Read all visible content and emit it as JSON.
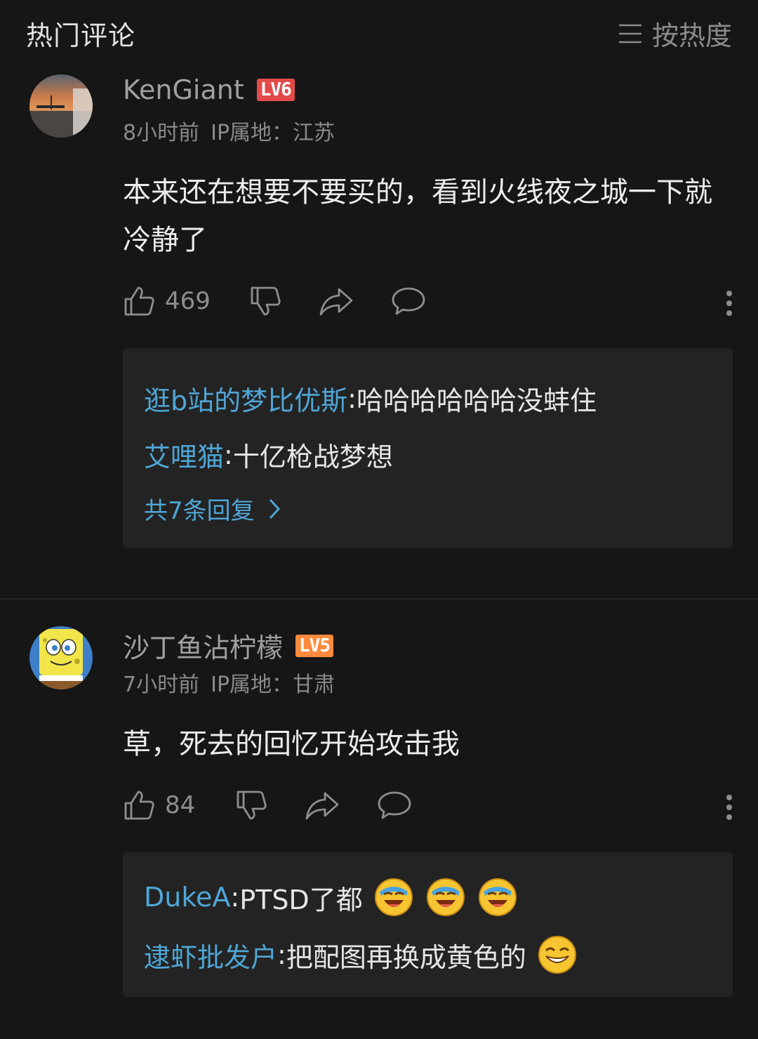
{
  "header": {
    "title": "热门评论",
    "sort_label": "按热度"
  },
  "comments": [
    {
      "username": "KenGiant",
      "level": "LV6",
      "time": "8小时前",
      "ip": "IP属地：江苏",
      "content": "本来还在想要不要买的，看到火线夜之城一下就冷静了",
      "likes": "469",
      "replies": [
        {
          "user": "逛b站的梦比优斯",
          "text": "哈哈哈哈哈哈没蚌住"
        },
        {
          "user": "艾哩猫",
          "text": "十亿枪战梦想"
        }
      ],
      "reply_count_label": "共7条回复"
    },
    {
      "username": "沙丁鱼沾柠檬",
      "level": "LV5",
      "time": "7小时前",
      "ip": "IP属地：甘肃",
      "content": "草，死去的回忆开始攻击我",
      "likes": "84",
      "replies": [
        {
          "user": "DukeA",
          "text": "PTSD了都"
        },
        {
          "user": "逮虾批发户",
          "text": "把配图再换成黄色的"
        }
      ]
    }
  ],
  "colors": {
    "background": "#161616",
    "reply_box": "#232323",
    "link_blue": "#4fa6d6",
    "lv6_red": "#e24a4a",
    "lv5_orange": "#ff8a3d"
  },
  "icons": [
    "sort-lines-icon",
    "thumb-up-icon",
    "thumb-down-icon",
    "share-icon",
    "comment-bubble-icon",
    "more-vertical-icon",
    "chevron-right-icon",
    "laugh-cry-emoji",
    "grin-emoji"
  ]
}
